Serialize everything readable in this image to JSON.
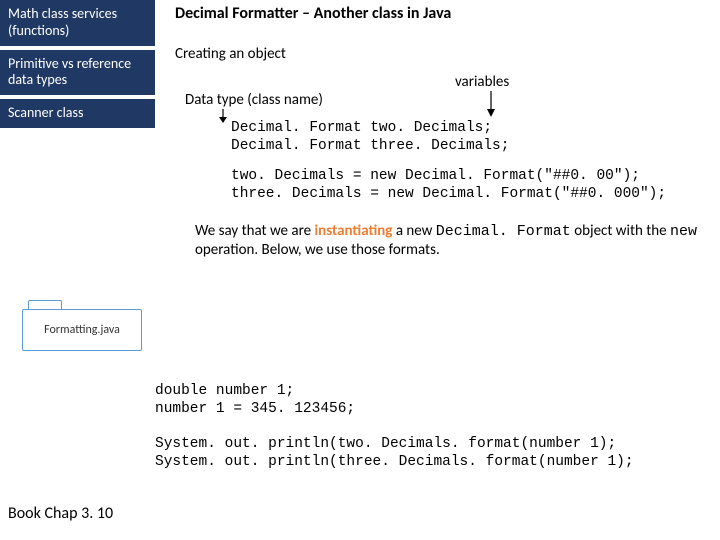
{
  "sidebar": {
    "items": [
      {
        "label": "Math class services (functions)"
      },
      {
        "label": "Primitive vs reference data types"
      },
      {
        "label": "Scanner class"
      }
    ]
  },
  "main": {
    "title": "Decimal Formatter – Another class in Java",
    "subtitle": "Creating an object",
    "annot_data_type": "Data type (class name)",
    "annot_variables": "variables",
    "code1_line1": "Decimal. Format two. Decimals;",
    "code1_line2": "Decimal. Format three. Decimals;",
    "code2_line1": "two. Decimals = new Decimal. Format(\"##0. 00\");",
    "code2_line2": "three. Decimals = new Decimal. Format(\"##0. 000\");",
    "explain_pre": "We say that we are ",
    "explain_hl": "instantiating",
    "explain_mid1": " a new ",
    "explain_code1": "Decimal. Format",
    "explain_mid2": " object with the ",
    "explain_code2": "new",
    "explain_post": " operation.  Below, we use those formats."
  },
  "folder": {
    "label": "Formatting.java"
  },
  "bottom": {
    "b1_line1": "double number 1;",
    "b1_line2": "number 1 = 345. 123456;",
    "b2_line1": "System. out. println(two. Decimals. format(number 1);",
    "b2_line2": "System. out. println(three. Decimals. format(number 1);"
  },
  "footer": {
    "book": "Book Chap 3. 10"
  }
}
